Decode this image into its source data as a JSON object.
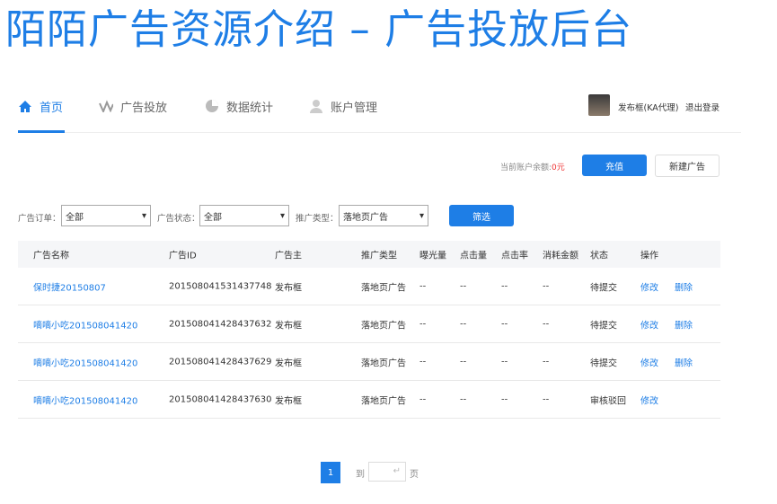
{
  "title": "陌陌广告资源介绍 – 广告投放后台",
  "nav": [
    {
      "label": "首页",
      "icon": "home-icon"
    },
    {
      "label": "广告投放",
      "icon": "pulse-icon"
    },
    {
      "label": "数据统计",
      "icon": "pie-chart-icon"
    },
    {
      "label": "账户管理",
      "icon": "user-icon"
    }
  ],
  "user": {
    "name": "发布框(KA代理)",
    "logout": "退出登录"
  },
  "balance": {
    "label": "当前账户余额:",
    "amount": "0元"
  },
  "buttons": {
    "recharge": "充值",
    "new_ad": "新建广告",
    "filter": "筛选"
  },
  "filters": [
    {
      "label": "广告订单：",
      "value": "全部"
    },
    {
      "label": "广告状态：",
      "value": "全部"
    },
    {
      "label": "推广类型：",
      "value": "落地页广告"
    }
  ],
  "table": {
    "headers": [
      "广告名称",
      "广告ID",
      "广告主",
      "推广类型",
      "曝光量",
      "点击量",
      "点击率",
      "消耗金额",
      "状态",
      "操作"
    ],
    "rows": [
      {
        "name": "保时捷20150807",
        "id": "201508041531437748",
        "owner": "发布框",
        "type": "落地页广告",
        "exposure": "--",
        "clicks": "--",
        "ctr": "--",
        "spend": "--",
        "status": "待提交",
        "edit": "修改",
        "delete": "删除"
      },
      {
        "name": "嘀嘀小吃201508041420",
        "id": "201508041428437632",
        "owner": "发布框",
        "type": "落地页广告",
        "exposure": "--",
        "clicks": "--",
        "ctr": "--",
        "spend": "--",
        "status": "待提交",
        "edit": "修改",
        "delete": "删除"
      },
      {
        "name": "嘀嘀小吃201508041420",
        "id": "201508041428437629",
        "owner": "发布框",
        "type": "落地页广告",
        "exposure": "--",
        "clicks": "--",
        "ctr": "--",
        "spend": "--",
        "status": "待提交",
        "edit": "修改",
        "delete": "删除"
      },
      {
        "name": "嘀嘀小吃201508041420",
        "id": "201508041428437630",
        "owner": "发布框",
        "type": "落地页广告",
        "exposure": "--",
        "clicks": "--",
        "ctr": "--",
        "spend": "--",
        "status": "审核驳回",
        "edit": "修改"
      }
    ]
  },
  "pagination": {
    "current": "1",
    "goto": "到",
    "page": "页"
  }
}
